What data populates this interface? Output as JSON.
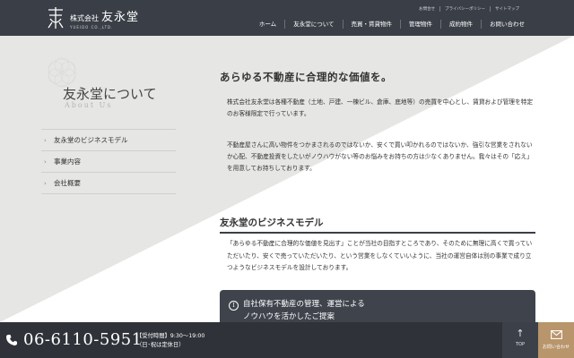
{
  "header": {
    "logo_company": "株式会社",
    "logo_name": "友永堂",
    "logo_sub": "YUEIDO CO.,LTD.",
    "util_links": [
      "お問合せ",
      "プライバシーポリシー",
      "サイトマップ"
    ],
    "nav": [
      "ホーム",
      "友永堂について",
      "売買・賃貸物件",
      "管理物件",
      "成約物件",
      "お問い合わせ"
    ]
  },
  "sidebar": {
    "title": "友永堂について",
    "subtitle": "About Us",
    "items": [
      {
        "label": "友永堂のビジネスモデル"
      },
      {
        "label": "事業内容"
      },
      {
        "label": "会社概要"
      }
    ]
  },
  "main": {
    "heading": "あらゆる不動産に合理的な価値を。",
    "para1": "株式会社友永堂は各種不動産（土地、戸建、一棟ビル、倉庫、底地等）の売買を中心とし、賃貸および管理を特定のお客様限定で行っています。",
    "para2": "不動産屋さんに高い物件をつかまされるのではないか、安くで買い叩かれるのではないか、強引な営業をされないか心配、不動産投資をしたいがノウハウがない等のお悩みをお持ちの方は少なくありません。我々はその「応え」を用意してお持ちしております。",
    "section_title": "友永堂のビジネスモデル",
    "para3": "「あらゆる不動産に合理的な価値を見出す」ことが当社の目指すところであり、そのために無理に高くで買っていただいたり、安くで売っていただいたり、という営業をしなくていいように、当社の運営自体は別の事業で成り立つようなビジネスモデルを設計しております。",
    "feature_number": "Ⅰ",
    "feature_line1": "自社保有不動産の管理、運営による",
    "feature_line2": "ノウハウを活かしたご提案"
  },
  "footer": {
    "phone": "06-6110-5951",
    "hours_line1": "【受付時間】9:30～19:00",
    "hours_line2": "（日･祝は定休日）",
    "top_label": "TOP",
    "contact_label": "お問い合わせ"
  },
  "colors": {
    "header_bg": "#3a3f47",
    "footer_bg": "#2f3339",
    "accent": "#b8956a",
    "bg_light": "#f4f4f2",
    "bg_diag": "#e6e6e4"
  }
}
